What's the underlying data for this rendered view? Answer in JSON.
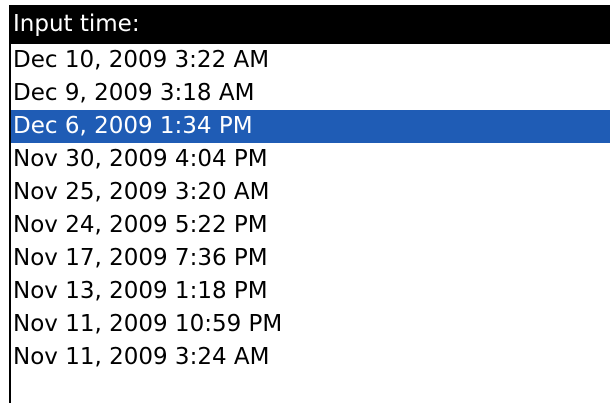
{
  "header": {
    "title": "Input time:"
  },
  "list": {
    "selected_index": 2,
    "items": [
      "Dec 10, 2009 3:22 AM",
      "Dec 9, 2009 3:18 AM",
      "Dec 6, 2009 1:34 PM",
      "Nov 30, 2009 4:04 PM",
      "Nov 25, 2009 3:20 AM",
      "Nov 24, 2009 5:22 PM",
      "Nov 17, 2009 7:36 PM",
      "Nov 13, 2009 1:18 PM",
      "Nov 11, 2009 10:59 PM",
      "Nov 11, 2009 3:24 AM"
    ]
  },
  "colors": {
    "title_background": "#000000",
    "title_text": "#ffffff",
    "selection_background": "#1f5cb5",
    "selection_text": "#ffffff",
    "list_text": "#000000",
    "background": "#ffffff"
  }
}
